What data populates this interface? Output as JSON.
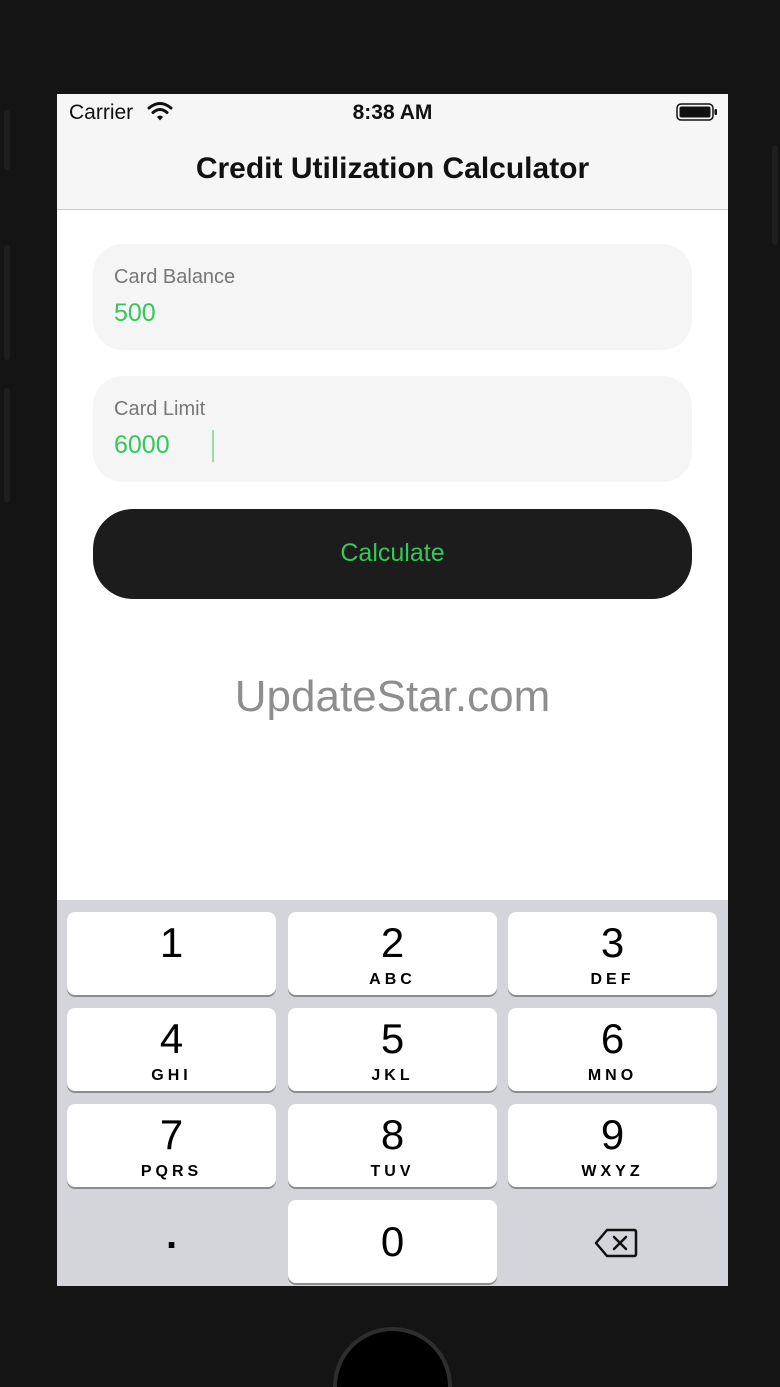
{
  "status_bar": {
    "carrier": "Carrier",
    "time": "8:38 AM"
  },
  "nav": {
    "title": "Credit Utilization Calculator"
  },
  "form": {
    "balance": {
      "label": "Card Balance",
      "value": "500"
    },
    "limit": {
      "label": "Card Limit",
      "value": "6000"
    },
    "calculate_label": "Calculate"
  },
  "watermark": "UpdateStar.com",
  "keypad": {
    "keys": [
      {
        "num": "1",
        "letters": ""
      },
      {
        "num": "2",
        "letters": "ABC"
      },
      {
        "num": "3",
        "letters": "DEF"
      },
      {
        "num": "4",
        "letters": "GHI"
      },
      {
        "num": "5",
        "letters": "JKL"
      },
      {
        "num": "6",
        "letters": "MNO"
      },
      {
        "num": "7",
        "letters": "PQRS"
      },
      {
        "num": "8",
        "letters": "TUV"
      },
      {
        "num": "9",
        "letters": "WXYZ"
      }
    ],
    "dot": ".",
    "zero": "0"
  },
  "colors": {
    "accent": "#34c759",
    "button_bg": "#1c1c1c",
    "keypad_bg": "#d3d5db"
  },
  "icons": {
    "wifi": "wifi-icon",
    "battery": "battery-icon",
    "delete": "delete-backspace-icon"
  }
}
